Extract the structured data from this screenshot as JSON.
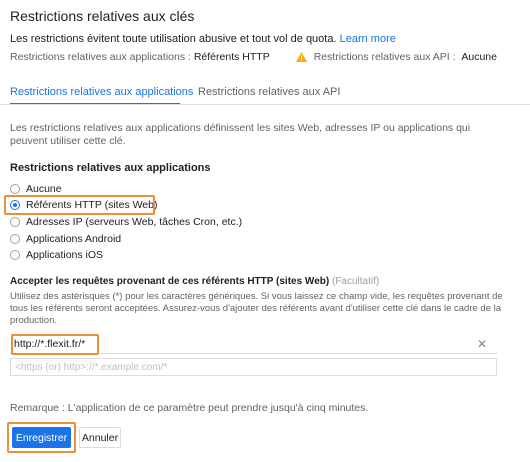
{
  "header": {
    "title": "Restrictions relatives aux clés",
    "description": "Les restrictions évitent toute utilisation abusive et tout vol de quota.",
    "learn_more": "Learn more"
  },
  "summary": {
    "app_label": "Restrictions relatives aux applications :",
    "app_value": "Référents HTTP",
    "api_label": "Restrictions relatives aux API :",
    "api_value": "Aucune",
    "warning_icon": "warning-triangle-icon",
    "warning_color": "#f9ab00"
  },
  "tabs": [
    {
      "label": "Restrictions relatives aux applications",
      "active": true
    },
    {
      "label": "Restrictions relatives aux API",
      "active": false
    }
  ],
  "app_section": {
    "intro": "Les restrictions relatives aux applications définissent les sites Web, adresses IP ou applications qui peuvent utiliser cette clé.",
    "heading": "Restrictions relatives aux applications",
    "options": [
      {
        "label": "Aucune",
        "checked": false
      },
      {
        "label": "Référents HTTP (sites Web)",
        "checked": true
      },
      {
        "label": "Adresses IP (serveurs Web, tâches Cron, etc.)",
        "checked": false
      },
      {
        "label": "Applications Android",
        "checked": false
      },
      {
        "label": "Applications iOS",
        "checked": false
      }
    ]
  },
  "referrers": {
    "label": "Accepter les requêtes provenant de ces référents HTTP (sites Web)",
    "optional": "(Facultatif)",
    "help": "Utilisez des astérisques (*) pour les caractères génériques. Si vous laissez ce champ vide, les requêtes provenant de tous les référents seront acceptées. Assurez-vous d'ajouter des référents avant d'utiliser cette clé dans le cadre de la production.",
    "entries": [
      "http://*.flexit.fr/*"
    ],
    "clear_glyph": "✕",
    "placeholder": "<https (or) http>://*.example.com/*",
    "new_value": ""
  },
  "footer": {
    "remark": "Remarque : L'application de ce paramètre peut prendre jusqu'à cinq minutes.",
    "save_label": "Enregistrer",
    "cancel_label": "Annuler"
  },
  "colors": {
    "accent": "#1a73e8",
    "highlight": "#e8913a"
  }
}
